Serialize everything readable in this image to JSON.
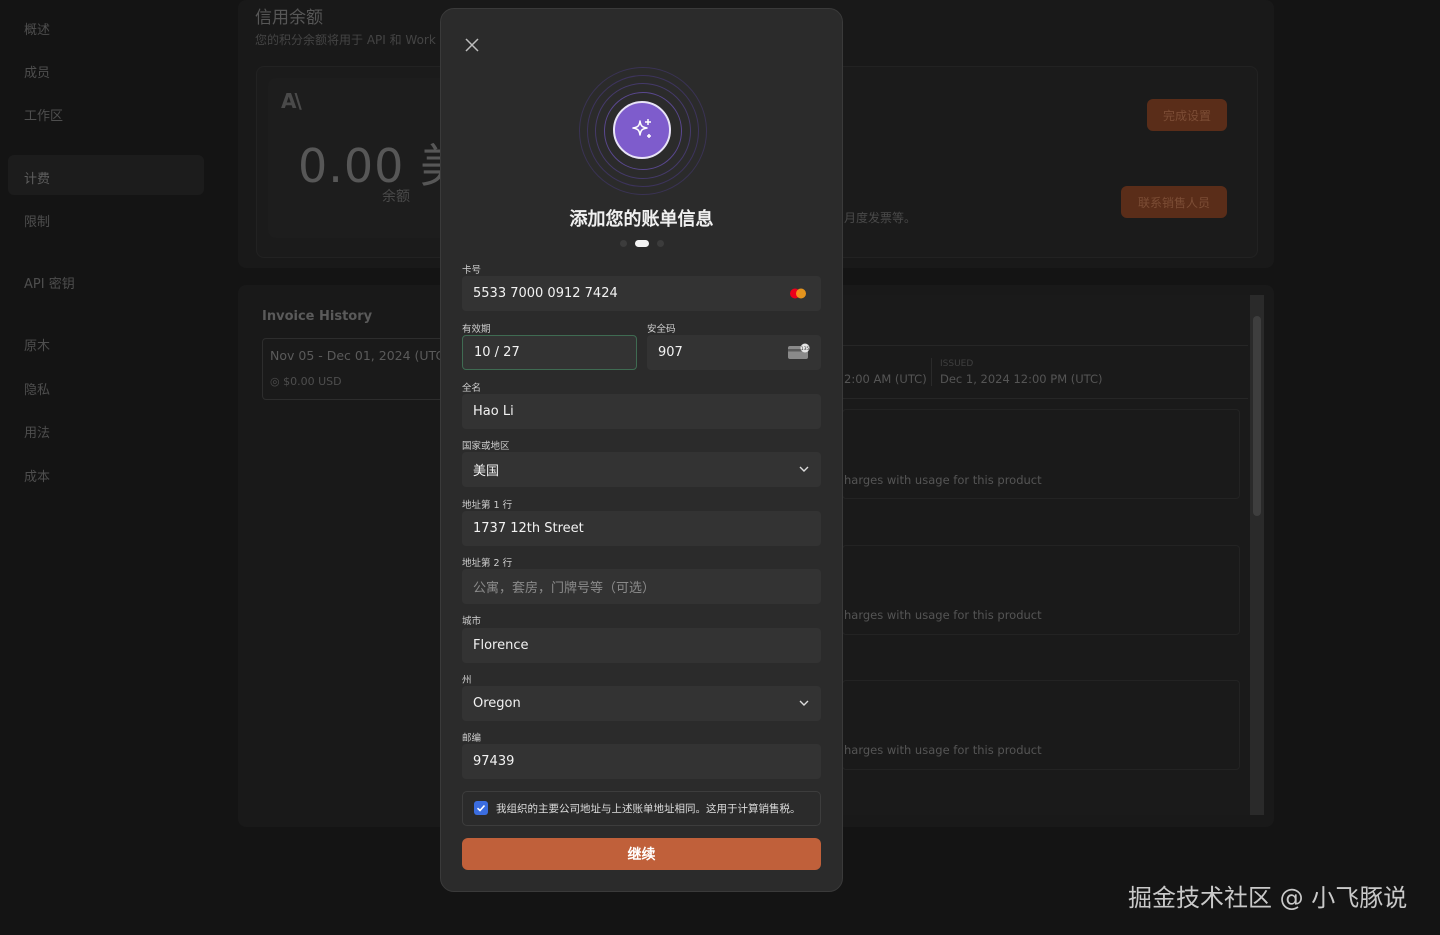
{
  "sidebar": {
    "items": [
      {
        "label": "概述"
      },
      {
        "label": "成员"
      },
      {
        "label": "工作区"
      },
      {
        "label": "计费"
      },
      {
        "label": "限制"
      },
      {
        "label": "API 密钥"
      },
      {
        "label": "原木"
      },
      {
        "label": "隐私"
      },
      {
        "label": "用法"
      },
      {
        "label": "成本"
      }
    ]
  },
  "balance": {
    "title": "信用余额",
    "subtitle": "您的积分余额将用于 API 和 Work",
    "logo": "A\\",
    "amount": "0.00 美",
    "amount_label": "余额",
    "setup_button": "完成设置",
    "sales_button": "联系销售人员",
    "invoice_note": "月度发票等。"
  },
  "invoice_history": {
    "title": "Invoice History",
    "rows": [
      {
        "range": "Nov 05 - Dec 01, 2024 (UTC",
        "amount": "$0.00 USD"
      }
    ],
    "detail": {
      "start_time": "2:00 AM (UTC)",
      "issued_label": "ISSUED",
      "issued_time": "Dec 1, 2024 12:00 PM (UTC)",
      "products": [
        {
          "text": "harges with usage for this product"
        },
        {
          "text": "harges with usage for this product"
        },
        {
          "text": "harges with usage for this product"
        }
      ]
    }
  },
  "modal": {
    "title": "添加您的账单信息",
    "step_current": 2,
    "step_total": 3,
    "fields": {
      "card_number": {
        "label": "卡号",
        "value": "5533 7000 0912 7424"
      },
      "expiry": {
        "label": "有效期",
        "value": "10 / 27"
      },
      "cvc": {
        "label": "安全码",
        "value": "907"
      },
      "full_name": {
        "label": "全名",
        "value": "Hao Li"
      },
      "country": {
        "label": "国家或地区",
        "value": "美国"
      },
      "address1": {
        "label": "地址第 1 行",
        "value": "1737 12th Street"
      },
      "address2": {
        "label": "地址第 2 行",
        "placeholder": "公寓，套房，门牌号等（可选）"
      },
      "city": {
        "label": "城市",
        "value": "Florence"
      },
      "state": {
        "label": "州",
        "value": "Oregon"
      },
      "zip": {
        "label": "邮编",
        "value": "97439"
      }
    },
    "checkbox_label": "我组织的主要公司地址与上述账单地址相同。这用于计算销售税。",
    "checkbox_checked": true,
    "continue_button": "继续"
  },
  "watermark": "掘金技术社区 @ 小飞豚说",
  "colors": {
    "accent": "#c0603a",
    "icon_purple": "#7e5ccc",
    "checkbox_blue": "#3b6de0",
    "focus_green": "#3f6b52"
  }
}
